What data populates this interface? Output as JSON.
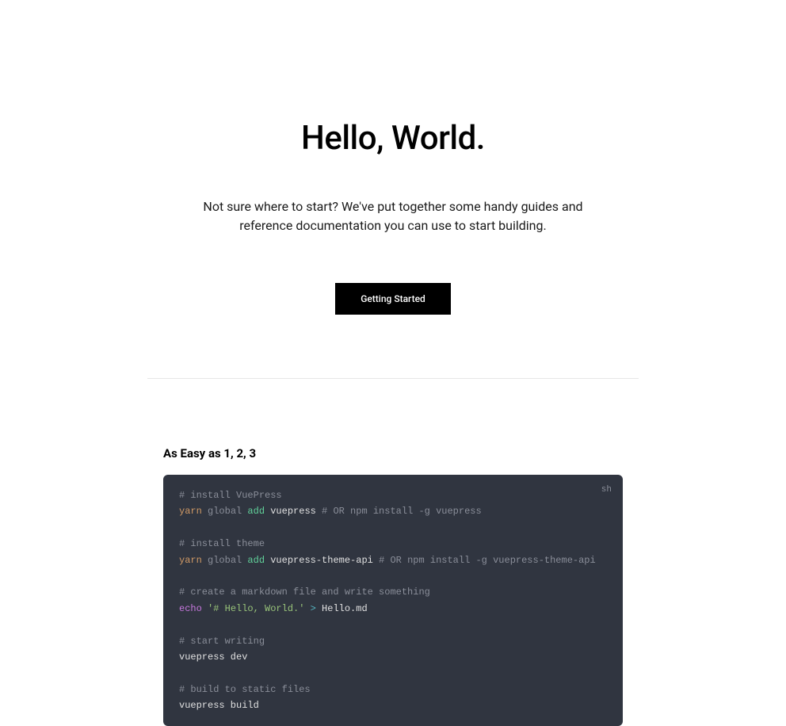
{
  "hero": {
    "title": "Hello, World.",
    "description": "Not sure where to start? We've put together some handy guides and reference documentation you can use to start building.",
    "cta_label": "Getting Started"
  },
  "section": {
    "title": "As Easy as 1, 2, 3",
    "code_lang": "sh"
  },
  "code": {
    "c1": "# install VuePress",
    "l2_yarn": "yarn",
    "l2_global": " global ",
    "l2_add": "add",
    "l2_pkg": " vuepress ",
    "l2_comment": "# OR npm install -g vuepress",
    "c3": "# install theme",
    "l4_yarn": "yarn",
    "l4_global": " global ",
    "l4_add": "add",
    "l4_pkg": " vuepress-theme-api ",
    "l4_comment": "# OR npm install -g vuepress-theme-api",
    "c5": "# create a markdown file and write something",
    "l6_echo": "echo",
    "l6_str": " '# Hello, World.'",
    "l6_op": " > ",
    "l6_file": "Hello.md",
    "c7": "# start writing",
    "l8": "vuepress dev",
    "c9": "# build to static files",
    "l10": "vuepress build"
  }
}
